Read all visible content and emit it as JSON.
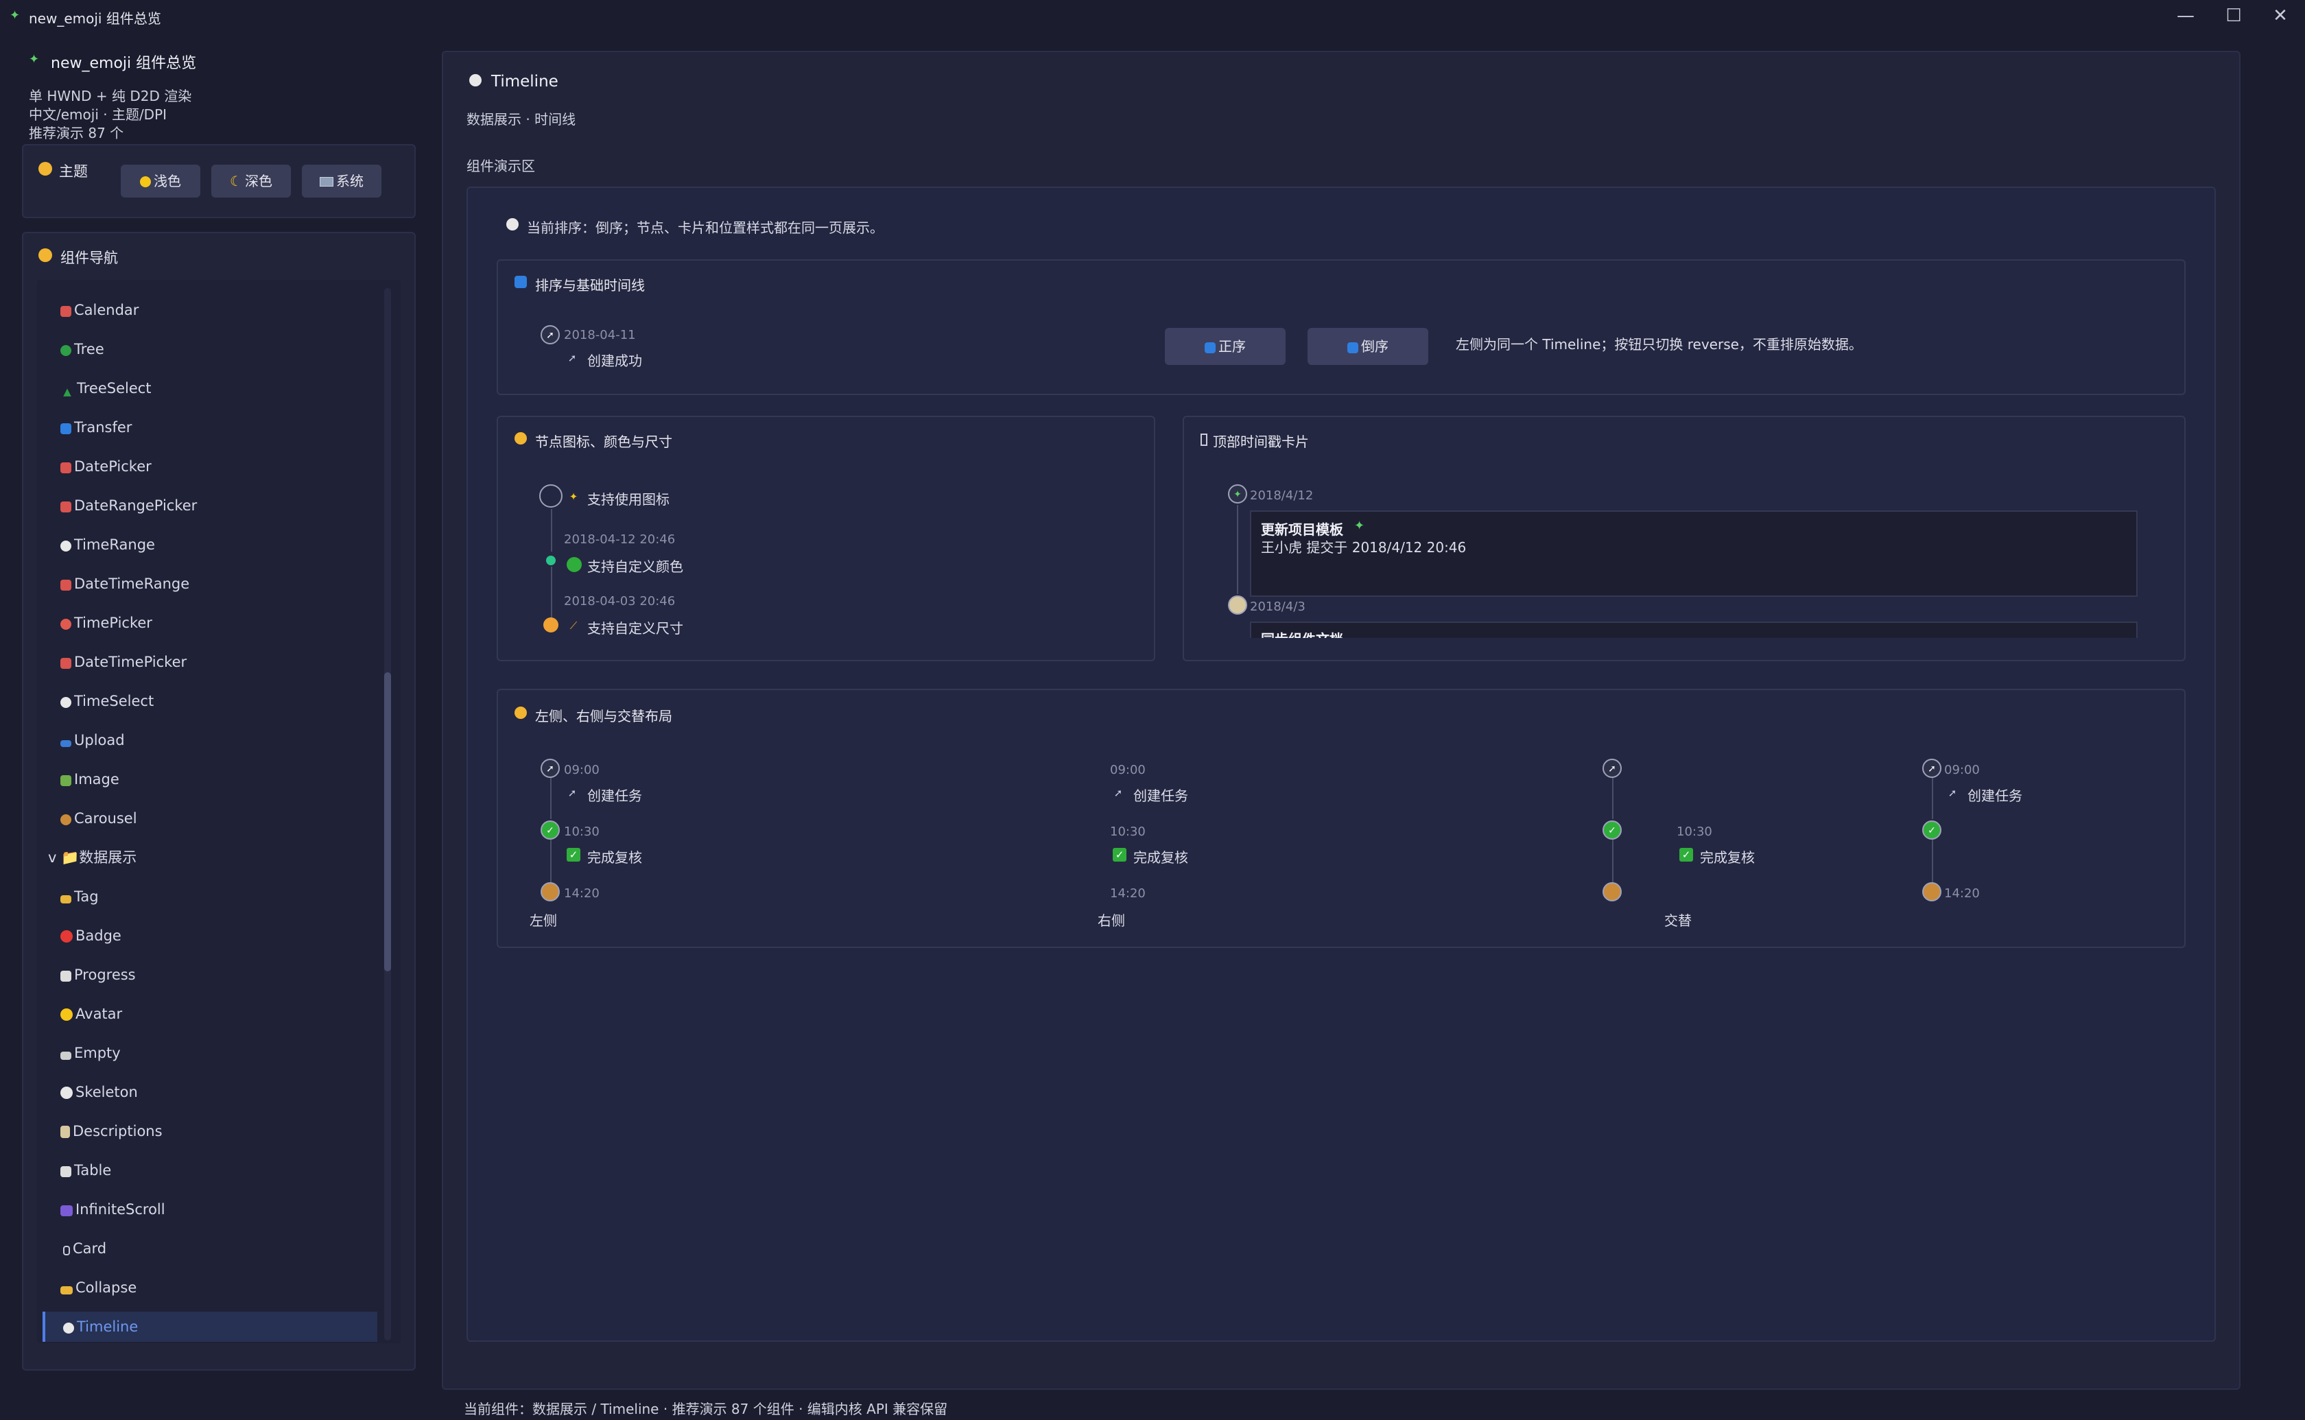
{
  "window": {
    "title": "new_emoji 组件总览",
    "minimize": "—",
    "maximize": "☐",
    "close": "✕"
  },
  "sidebar": {
    "app_title": "new_emoji 组件总览",
    "lines": [
      "单 HWND + 纯 D2D 渲染",
      "中文/emoji · 主题/DPI",
      "推荐演示 87 个"
    ],
    "theme_label": "主题",
    "theme_buttons": [
      "浅色",
      "深色",
      "系统"
    ],
    "nav_title": "组件导航",
    "items": [
      "Calendar",
      "Tree",
      "TreeSelect",
      "Transfer",
      "DatePicker",
      "DateRangePicker",
      "TimeRange",
      "DateTimeRange",
      "TimePicker",
      "DateTimePicker",
      "TimeSelect",
      "Upload",
      "Image",
      "Carousel",
      "v 📁数据展示",
      "Tag",
      "Badge",
      "Progress",
      "Avatar",
      "Empty",
      "Skeleton",
      "Descriptions",
      "Table",
      "InfiniteScroll",
      "Card",
      "Collapse",
      "Timeline"
    ]
  },
  "main": {
    "title": "Timeline",
    "crumb": "数据展示 · 时间线",
    "demo_label": "组件演示区",
    "order_note": "当前排序：倒序；节点、卡片和位置样式都在同一页展示。",
    "sort_card": {
      "title": "排序与基础时间线",
      "ts": "2018-04-11",
      "text": "创建成功",
      "btn_asc": "正序",
      "btn_desc": "倒序",
      "hint": "左侧为同一个 Timeline；按钮只切换 reverse，不重排原始数据。"
    },
    "icon_card": {
      "title": "节点图标、颜色与尺寸",
      "item1": "支持使用图标",
      "ts2": "2018-04-12 20:46",
      "item2": "支持自定义颜色",
      "ts3": "2018-04-03 20:46",
      "item3": "支持自定义尺寸"
    },
    "top_card": {
      "title": "顶部时间戳卡片",
      "date1": "2018/4/12",
      "card1_title": "更新项目模板",
      "card1_sub": "王小虎 提交于 2018/4/12 20:46",
      "date2": "2018/4/3",
      "card2_title": "同步组件文档"
    },
    "layout_card": {
      "title": "左侧、右侧与交替布局",
      "t1": "09:00",
      "e1": "创建任务",
      "t2": "10:30",
      "e2": "完成复核",
      "t3": "14:20",
      "left_label": "左侧",
      "right_label": "右侧",
      "alt_label": "交替"
    }
  },
  "status": "当前组件：数据展示 / Timeline · 推荐演示 87 个组件 · 编辑内核 API 兼容保留"
}
